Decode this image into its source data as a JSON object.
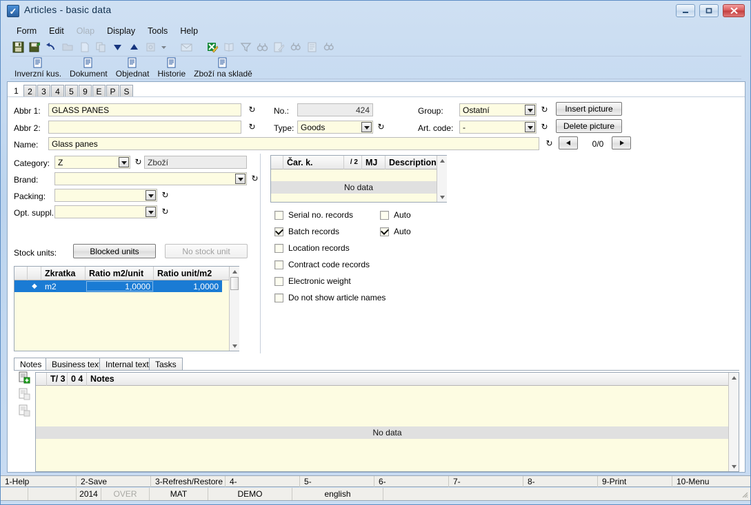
{
  "window": {
    "title": "Articles - basic data",
    "icon": "app-icon",
    "controls": {
      "minimize": "minimize",
      "maximize": "maximize",
      "close": "close"
    }
  },
  "menu": [
    {
      "label": "Form",
      "disabled": false
    },
    {
      "label": "Edit",
      "disabled": false
    },
    {
      "label": "Olap",
      "disabled": true
    },
    {
      "label": "Display",
      "disabled": false
    },
    {
      "label": "Tools",
      "disabled": false
    },
    {
      "label": "Help",
      "disabled": false
    }
  ],
  "toolbar_main": [
    {
      "name": "save-icon",
      "enabled": true
    },
    {
      "name": "save-as-icon",
      "enabled": true
    },
    {
      "name": "undo-icon",
      "enabled": true
    },
    {
      "name": "open-folder-icon",
      "enabled": false
    },
    {
      "name": "new-document-icon",
      "enabled": false
    },
    {
      "name": "copy-icon",
      "enabled": false
    },
    {
      "name": "arrow-down-icon",
      "enabled": true
    },
    {
      "name": "arrow-up-icon",
      "enabled": true
    },
    {
      "name": "link-icon",
      "enabled": false
    },
    {
      "name": "dropdown-arrow-icon",
      "enabled": false
    },
    {
      "name": "envelope-icon",
      "enabled": false
    },
    {
      "name": "excel-export-icon",
      "enabled": true
    },
    {
      "name": "book-icon",
      "enabled": false
    },
    {
      "name": "filter-icon",
      "enabled": false
    },
    {
      "name": "binoculars-icon",
      "enabled": false
    },
    {
      "name": "edit-page-icon",
      "enabled": false
    },
    {
      "name": "find-next-icon",
      "enabled": false
    },
    {
      "name": "list-icon",
      "enabled": false
    },
    {
      "name": "find-prev-icon",
      "enabled": false
    }
  ],
  "toolbar_buttons": [
    {
      "label": "Inverzní kus.",
      "icon": "document-icon"
    },
    {
      "label": "Dokument",
      "icon": "document-icon"
    },
    {
      "label": "Objednat",
      "icon": "document-icon"
    },
    {
      "label": "Historie",
      "icon": "document-icon"
    },
    {
      "label": "Zboží na skladě",
      "icon": "document-icon"
    }
  ],
  "tabs": [
    {
      "label": "1",
      "active": true
    },
    {
      "label": "2",
      "active": false
    },
    {
      "label": "3",
      "active": false
    },
    {
      "label": "4",
      "active": false
    },
    {
      "label": "5",
      "active": false
    },
    {
      "label": "9",
      "active": false
    },
    {
      "label": "E",
      "active": false
    },
    {
      "label": "P",
      "active": false
    },
    {
      "label": "S",
      "active": false
    }
  ],
  "form": {
    "abbr1": {
      "label": "Abbr 1:",
      "value": "GLASS PANES"
    },
    "abbr2": {
      "label": "Abbr 2:",
      "value": ""
    },
    "name": {
      "label": "Name:",
      "value": "Glass panes"
    },
    "no": {
      "label": "No.:",
      "value": "424"
    },
    "type": {
      "label": "Type:",
      "value": "Goods"
    },
    "group": {
      "label": "Group:",
      "value": "Ostatní"
    },
    "art_code": {
      "label": "Art. code:",
      "value": "-"
    },
    "category": {
      "label": "Category:",
      "value": "Z",
      "display": "Zboží"
    },
    "brand": {
      "label": "Brand:",
      "value": ""
    },
    "packing": {
      "label": "Packing:",
      "value": ""
    },
    "opt_suppl": {
      "label": "Opt. suppl.:",
      "value": ""
    }
  },
  "picture": {
    "insert_label": "Insert picture",
    "delete_label": "Delete picture",
    "prev_icon": "prev-arrow-icon",
    "next_icon": "next-arrow-icon",
    "counter": "0/0"
  },
  "barcode_grid": {
    "columns": [
      "",
      "Čar. k.",
      "/ 2",
      "MJ",
      "Description"
    ],
    "empty_text": "No data",
    "rows": []
  },
  "checkboxes": [
    {
      "label": "Serial no. records",
      "checked": false
    },
    {
      "label": "Batch records",
      "checked": true
    },
    {
      "label": "Location records",
      "checked": false
    },
    {
      "label": "Contract code records",
      "checked": false
    },
    {
      "label": "Electronic weight",
      "checked": false
    },
    {
      "label": "Do not show article names",
      "checked": false
    }
  ],
  "auto_checkboxes": [
    {
      "label": "Auto",
      "checked": false
    },
    {
      "label": "Auto",
      "checked": true
    }
  ],
  "stock_units": {
    "label": "Stock units:",
    "blocked_button": "Blocked units",
    "no_stock_button": "No stock unit",
    "columns": [
      "",
      "",
      "Zkratka",
      "Ratio m2/unit",
      "Ratio unit/m2"
    ],
    "rows": [
      {
        "marker": "◆",
        "zkratka": "m2",
        "ratio_m2_unit": "1,0000",
        "ratio_unit_m2": "1,0000",
        "selected": true
      }
    ]
  },
  "notes_tabs": [
    {
      "label": "Notes",
      "active": true
    },
    {
      "label": "Business text",
      "active": false
    },
    {
      "label": "Internal text",
      "active": false
    },
    {
      "label": "Tasks",
      "active": false
    }
  ],
  "notes_side_icons": [
    {
      "name": "add-note-icon"
    },
    {
      "name": "view-note-icon"
    },
    {
      "name": "copy-note-icon"
    }
  ],
  "notes_grid": {
    "columns": [
      "",
      "T/ 3",
      "0 4",
      "Notes"
    ],
    "empty_text": "No data"
  },
  "function_keys": [
    {
      "label": "1-Help"
    },
    {
      "label": "2-Save"
    },
    {
      "label": "3-Refresh/Restore"
    },
    {
      "label": "4-"
    },
    {
      "label": "5-"
    },
    {
      "label": "6-"
    },
    {
      "label": "7-"
    },
    {
      "label": "8-"
    },
    {
      "label": "9-Print"
    },
    {
      "label": "10-Menu"
    }
  ],
  "status_bar": [
    {
      "label": "",
      "dim": false
    },
    {
      "label": "",
      "dim": false
    },
    {
      "label": "2014",
      "dim": false
    },
    {
      "label": "OVER",
      "dim": true
    },
    {
      "label": "MAT",
      "dim": false
    },
    {
      "label": "DEMO",
      "dim": false
    },
    {
      "label": "english",
      "dim": false
    },
    {
      "label": "",
      "dim": false
    }
  ],
  "colors": {
    "field_bg": "#fdfce2",
    "readonly_bg": "#ececec",
    "selection": "#1a7bd4",
    "title_text": "#10304f",
    "accent": "#5a8cc4"
  }
}
